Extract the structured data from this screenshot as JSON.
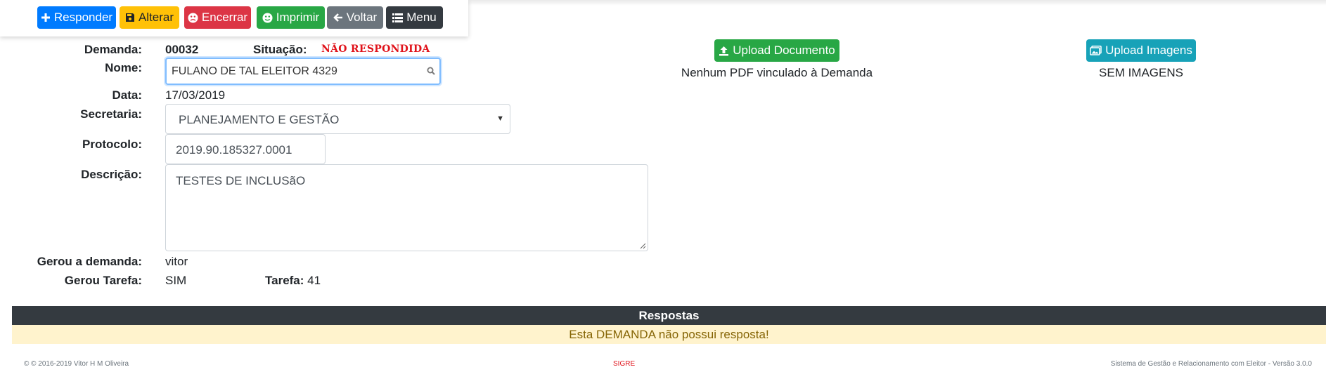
{
  "toolbar": {
    "responder": "Responder",
    "alterar": "Alterar",
    "encerrar": "Encerrar",
    "imprimir": "Imprimir",
    "voltar": "Voltar",
    "menu": "Menu"
  },
  "demanda": {
    "demanda_label": "Demanda:",
    "demanda_value": "00032",
    "situacao_label": "Situação:",
    "situacao_value": "NÃO RESPONDIDA",
    "nome_label": "Nome:",
    "nome_value": "FULANO DE TAL ELEITOR 4329",
    "data_label": "Data:",
    "data_value": "17/03/2019",
    "secretaria_label": "Secretaria:",
    "secretaria_value": "PLANEJAMENTO E GESTÃO",
    "protocolo_label": "Protocolo:",
    "protocolo_value": "2019.90.185327.0001",
    "descricao_label": "Descrição:",
    "descricao_value": "TESTES DE INCLUSãO",
    "gerou_demanda_label": "Gerou a demanda:",
    "gerou_demanda_value": "vitor",
    "gerou_tarefa_label": "Gerou Tarefa:",
    "gerou_tarefa_value": "SIM",
    "tarefa_label": "Tarefa:",
    "tarefa_value": "41"
  },
  "documents": {
    "upload_doc_label": "Upload Documento",
    "doc_status": "Nenhum PDF vinculado à Demanda",
    "upload_img_label": "Upload Imagens",
    "img_status": "SEM IMAGENS"
  },
  "respostas": {
    "header": "Respostas",
    "message": "Esta DEMANDA não possui resposta!"
  },
  "footer": {
    "copyright": "©  © 2016-2019 Vitor H M Oliveira",
    "app_name": "SIGRE",
    "version": "Sistema de Gestão e Relacionamento com Eleitor - Versão 3.0.0"
  },
  "colors": {
    "primary": "#007bff",
    "warning": "#ffc107",
    "danger": "#dc3545",
    "success": "#28a745",
    "secondary": "#6c757d",
    "dark": "#343a40",
    "info": "#17a2b8",
    "status_red": "#e0121a",
    "alert_bg": "#fff3cd"
  }
}
